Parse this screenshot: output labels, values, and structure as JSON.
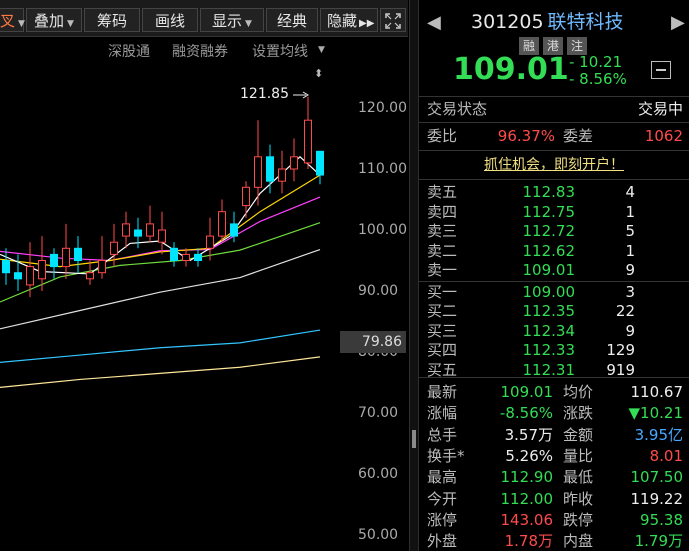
{
  "toolbar": {
    "items": [
      "叉",
      "叠加",
      "筹码",
      "画线",
      "显示",
      "经典",
      "隐藏"
    ],
    "more_icon": "double-right-arrow-icon",
    "expand_icon": "expand-icon"
  },
  "chart": {
    "subtabs": [
      "深股通",
      "融资融券",
      "设置均线"
    ],
    "peak_label": "121.85",
    "axis_labels": [
      "120.00",
      "110.00",
      "100.00",
      "90.00",
      "80.00",
      "70.00",
      "60.00",
      "50.00"
    ],
    "current_price_box": "79.86",
    "colors": {
      "up": "#ff4b4b",
      "down": "#00e5ff",
      "ma5": "#ffffff",
      "ma10": "#ffd700",
      "ma20": "#ff3fff",
      "ma30": "#6fdc3c",
      "ma60": "#e0e0e0",
      "ma120": "#33c6ff",
      "ma250": "#ffe89a"
    }
  },
  "quote": {
    "code": "301205",
    "name": "联特科技",
    "tags": [
      "融",
      "港",
      "注"
    ],
    "price": "109.01",
    "change": "- 10.21",
    "change_pct": "- 8.56%"
  },
  "status": {
    "label": "交易状态",
    "value": "交易中",
    "weibi_label": "委比",
    "weibi_value": "96.37%",
    "weicha_label": "委差",
    "weicha_value": "1062"
  },
  "promo": "抓住机会，即刻开户！",
  "order_book": {
    "asks": [
      {
        "label": "卖五",
        "price": "112.83",
        "vol": "4"
      },
      {
        "label": "卖四",
        "price": "112.75",
        "vol": "1"
      },
      {
        "label": "卖三",
        "price": "112.72",
        "vol": "5"
      },
      {
        "label": "卖二",
        "price": "112.62",
        "vol": "1"
      },
      {
        "label": "卖一",
        "price": "109.01",
        "vol": "9"
      }
    ],
    "bids": [
      {
        "label": "买一",
        "price": "109.00",
        "vol": "3"
      },
      {
        "label": "买二",
        "price": "112.35",
        "vol": "22"
      },
      {
        "label": "买三",
        "price": "112.34",
        "vol": "9"
      },
      {
        "label": "买四",
        "price": "112.33",
        "vol": "129"
      },
      {
        "label": "买五",
        "price": "112.31",
        "vol": "919"
      }
    ]
  },
  "stats": [
    {
      "l1": "最新",
      "v1": "109.01",
      "c1": "green",
      "l2": "均价",
      "v2": "110.67",
      "c2": "white"
    },
    {
      "l1": "涨幅",
      "v1": "-8.56%",
      "c1": "green",
      "l2": "涨跌",
      "v2": "▼10.21",
      "c2": "green"
    },
    {
      "l1": "总手",
      "v1": "3.57万",
      "c1": "white",
      "l2": "金额",
      "v2": "3.95亿",
      "c2": "blue"
    },
    {
      "l1": "换手*",
      "v1": "5.26%",
      "c1": "white",
      "l2": "量比",
      "v2": "8.01",
      "c2": "red"
    },
    {
      "l1": "最高",
      "v1": "112.90",
      "c1": "green",
      "l2": "最低",
      "v2": "107.50",
      "c2": "green"
    },
    {
      "l1": "今开",
      "v1": "112.00",
      "c1": "green",
      "l2": "昨收",
      "v2": "119.22",
      "c2": "white"
    },
    {
      "l1": "涨停",
      "v1": "143.06",
      "c1": "red",
      "l2": "跌停",
      "v2": "95.38",
      "c2": "green"
    },
    {
      "l1": "外盘",
      "v1": "1.78万",
      "c1": "red",
      "l2": "内盘",
      "v2": "1.79万",
      "c2": "green"
    }
  ]
}
